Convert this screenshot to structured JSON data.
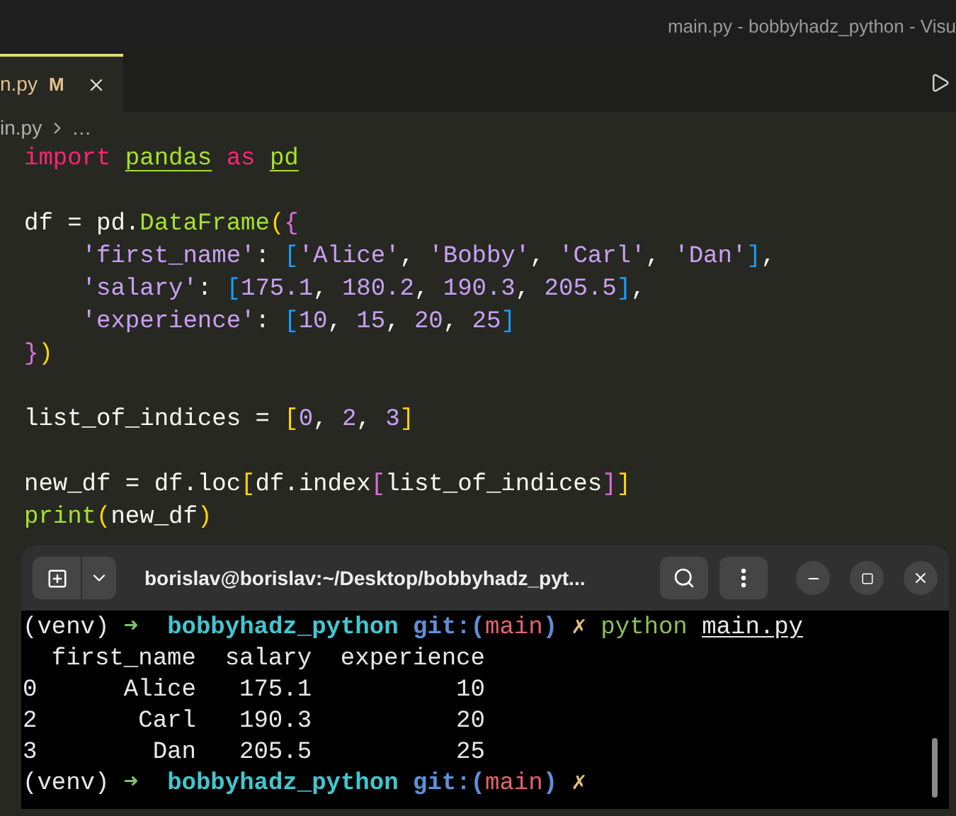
{
  "window": {
    "title": "main.py - bobbyhadz_python - Visu"
  },
  "tab": {
    "label": "n.py",
    "badge": "M",
    "selected": true
  },
  "breadcrumb": {
    "file": "in.py",
    "rest": "…"
  },
  "code_blocks": [
    [
      {
        "tokens": [
          {
            "kind": "keyword",
            "text": "import "
          },
          {
            "kind": "module",
            "text": "pandas"
          },
          {
            "kind": "keyword",
            "text": " as "
          },
          {
            "kind": "module",
            "text": "pd"
          }
        ]
      }
    ],
    [
      {
        "tokens": [
          {
            "kind": "plain",
            "text": "df = pd."
          },
          {
            "kind": "func",
            "text": "DataFrame"
          },
          {
            "kind": "bracket1",
            "text": "("
          },
          {
            "kind": "bracket2",
            "text": "{"
          }
        ]
      },
      {
        "tokens": [
          {
            "kind": "string",
            "text": "    'first_name'"
          },
          {
            "kind": "plain",
            "text": ": "
          },
          {
            "kind": "bracket3",
            "text": "["
          },
          {
            "kind": "string",
            "text": "'Alice'"
          },
          {
            "kind": "plain",
            "text": ", "
          },
          {
            "kind": "string",
            "text": "'Bobby'"
          },
          {
            "kind": "plain",
            "text": ", "
          },
          {
            "kind": "string",
            "text": "'Carl'"
          },
          {
            "kind": "plain",
            "text": ", "
          },
          {
            "kind": "string",
            "text": "'Dan'"
          },
          {
            "kind": "bracket3",
            "text": "]"
          },
          {
            "kind": "plain",
            "text": ","
          }
        ]
      },
      {
        "tokens": [
          {
            "kind": "string",
            "text": "    'salary'"
          },
          {
            "kind": "plain",
            "text": ": "
          },
          {
            "kind": "bracket3",
            "text": "["
          },
          {
            "kind": "number",
            "text": "175.1"
          },
          {
            "kind": "plain",
            "text": ", "
          },
          {
            "kind": "number",
            "text": "180.2"
          },
          {
            "kind": "plain",
            "text": ", "
          },
          {
            "kind": "number",
            "text": "190.3"
          },
          {
            "kind": "plain",
            "text": ", "
          },
          {
            "kind": "number",
            "text": "205.5"
          },
          {
            "kind": "bracket3",
            "text": "]"
          },
          {
            "kind": "plain",
            "text": ","
          }
        ]
      },
      {
        "tokens": [
          {
            "kind": "string",
            "text": "    'experience'"
          },
          {
            "kind": "plain",
            "text": ": "
          },
          {
            "kind": "bracket3",
            "text": "["
          },
          {
            "kind": "number",
            "text": "10"
          },
          {
            "kind": "plain",
            "text": ", "
          },
          {
            "kind": "number",
            "text": "15"
          },
          {
            "kind": "plain",
            "text": ", "
          },
          {
            "kind": "number",
            "text": "20"
          },
          {
            "kind": "plain",
            "text": ", "
          },
          {
            "kind": "number",
            "text": "25"
          },
          {
            "kind": "bracket3",
            "text": "]"
          }
        ]
      },
      {
        "tokens": [
          {
            "kind": "bracket2",
            "text": "}"
          },
          {
            "kind": "bracket1",
            "text": ")"
          }
        ]
      }
    ],
    [
      {
        "tokens": [
          {
            "kind": "plain",
            "text": "list_of_indices = "
          },
          {
            "kind": "bracket1",
            "text": "["
          },
          {
            "kind": "number",
            "text": "0"
          },
          {
            "kind": "plain",
            "text": ", "
          },
          {
            "kind": "number",
            "text": "2"
          },
          {
            "kind": "plain",
            "text": ", "
          },
          {
            "kind": "number",
            "text": "3"
          },
          {
            "kind": "bracket1",
            "text": "]"
          }
        ]
      }
    ],
    [
      {
        "tokens": [
          {
            "kind": "plain",
            "text": "new_df = df.loc"
          },
          {
            "kind": "bracket1",
            "text": "["
          },
          {
            "kind": "plain",
            "text": "df.index"
          },
          {
            "kind": "bracket2",
            "text": "["
          },
          {
            "kind": "plain",
            "text": "list_of_indices"
          },
          {
            "kind": "bracket2",
            "text": "]"
          },
          {
            "kind": "bracket1",
            "text": "]"
          }
        ]
      },
      {
        "tokens": [
          {
            "kind": "func",
            "text": "print"
          },
          {
            "kind": "bracket1",
            "text": "("
          },
          {
            "kind": "plain",
            "text": "new_df"
          },
          {
            "kind": "bracket1",
            "text": ")"
          }
        ]
      }
    ]
  ],
  "terminal": {
    "title": "borislav@borislav:~/Desktop/bobbyhadz_pyt...",
    "lines": [
      {
        "tokens": [
          {
            "kind": "plain",
            "text": "(venv) "
          },
          {
            "kind": "arrow",
            "text": "➜  "
          },
          {
            "kind": "dir",
            "text": "bobbyhadz_python "
          },
          {
            "kind": "git",
            "text": "git:("
          },
          {
            "kind": "branch",
            "text": "main"
          },
          {
            "kind": "git",
            "text": ") "
          },
          {
            "kind": "x",
            "text": "✗ "
          },
          {
            "kind": "cmd",
            "text": "python "
          },
          {
            "kind": "arg",
            "text": "main.py"
          }
        ]
      },
      {
        "tokens": [
          {
            "kind": "plain",
            "text": "  first_name  salary  experience"
          }
        ]
      },
      {
        "tokens": [
          {
            "kind": "plain",
            "text": "0      Alice   175.1          10"
          }
        ]
      },
      {
        "tokens": [
          {
            "kind": "plain",
            "text": "2       Carl   190.3          20"
          }
        ]
      },
      {
        "tokens": [
          {
            "kind": "plain",
            "text": "3        Dan   205.5          25"
          }
        ]
      },
      {
        "tokens": [
          {
            "kind": "plain",
            "text": "(venv) "
          },
          {
            "kind": "arrow",
            "text": "➜  "
          },
          {
            "kind": "dir",
            "text": "bobbyhadz_python "
          },
          {
            "kind": "git",
            "text": "git:("
          },
          {
            "kind": "branch",
            "text": "main"
          },
          {
            "kind": "git",
            "text": ") "
          },
          {
            "kind": "x",
            "text": "✗"
          }
        ]
      }
    ]
  }
}
